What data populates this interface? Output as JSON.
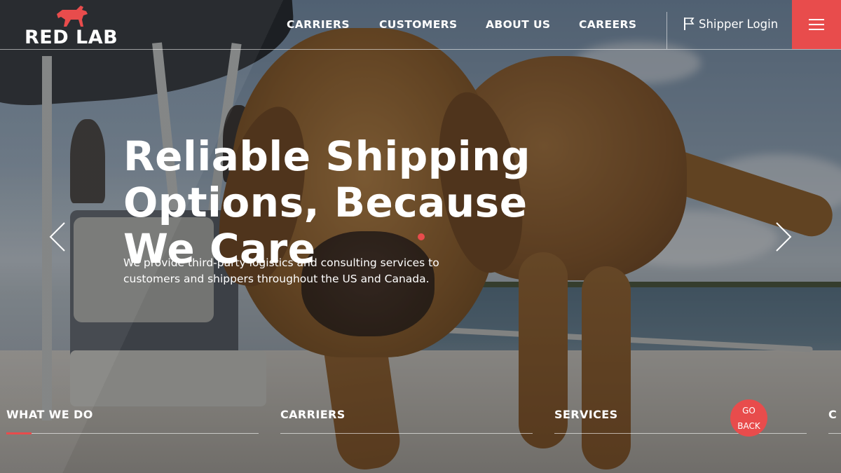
{
  "brand": {
    "name": "RED LAB",
    "accent_color": "#e84c4c"
  },
  "nav": {
    "items": [
      {
        "label": "CARRIERS"
      },
      {
        "label": "CUSTOMERS"
      },
      {
        "label": "ABOUT US"
      },
      {
        "label": "CAREERS"
      }
    ],
    "login": {
      "label": "Shipper Login",
      "icon": "flag-icon"
    },
    "menu": {
      "icon": "hamburger-menu-icon"
    }
  },
  "hero": {
    "headline": "Reliable Shipping Options, Because We Care",
    "subtext": "We provide third-party logistics and consulting services to customers and shippers throughout the US and Canada.",
    "prev_icon": "chevron-left-icon",
    "next_icon": "chevron-right-icon"
  },
  "tabs": [
    {
      "label": "WHAT WE DO"
    },
    {
      "label": "CARRIERS"
    },
    {
      "label": "SERVICES"
    },
    {
      "label": "C"
    }
  ],
  "go_back": {
    "line1": "GO",
    "line2": "BACK"
  }
}
